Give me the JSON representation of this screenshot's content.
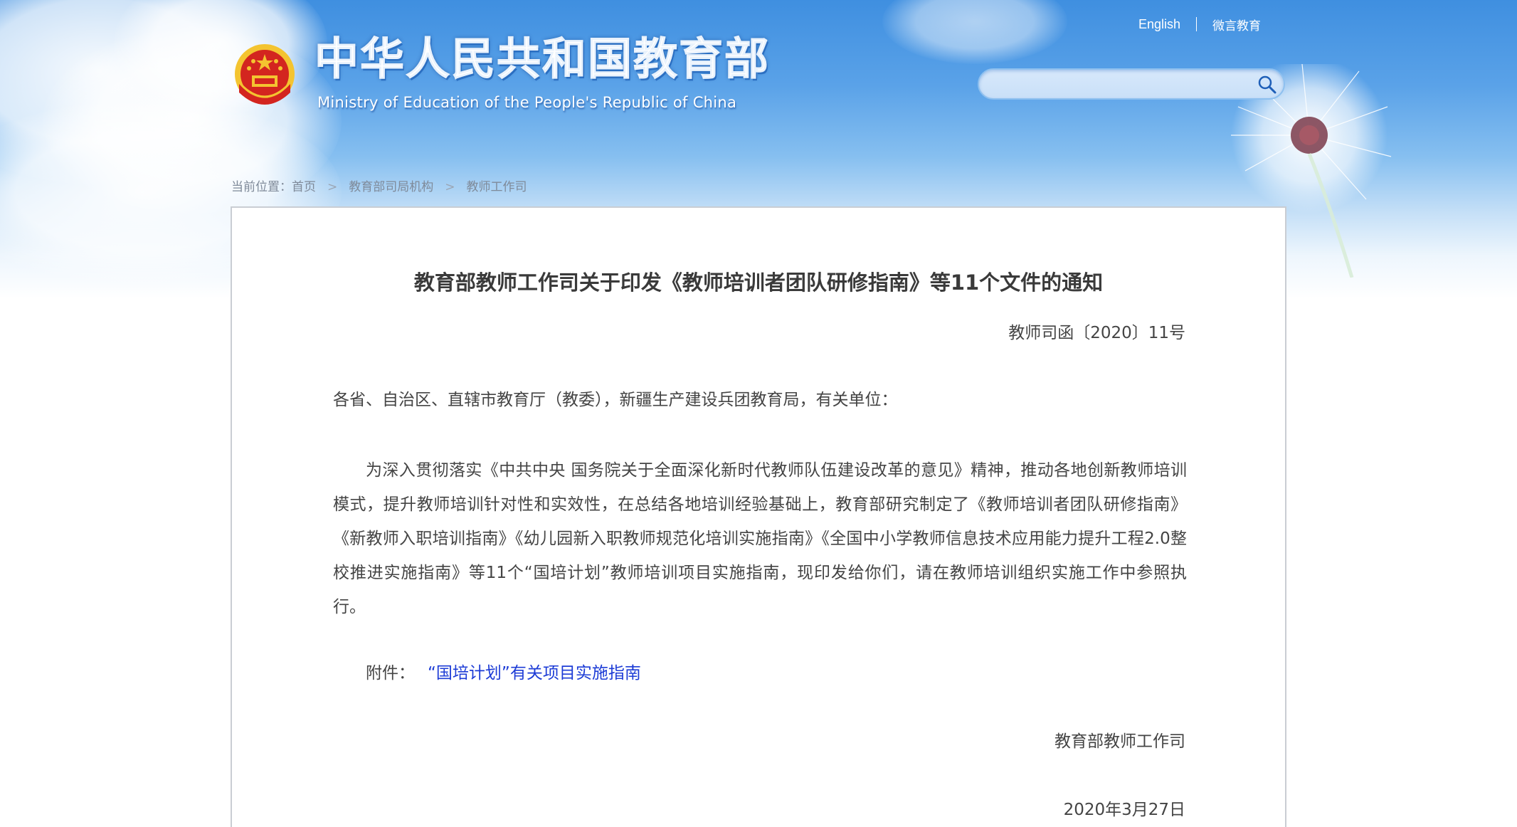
{
  "header": {
    "site_title_cn": "中华人民共和国教育部",
    "site_title_en": "Ministry of Education of the People's Republic of China",
    "links": {
      "english": "English",
      "weiyan": "微言教育"
    },
    "search": {
      "placeholder": ""
    }
  },
  "breadcrumb": {
    "prefix": "当前位置：",
    "items": [
      "首页",
      "教育部司局机构",
      "教师工作司"
    ],
    "separator": ">"
  },
  "article": {
    "title": "教育部教师工作司关于印发《教师培训者团队研修指南》等11个文件的通知",
    "doc_number": "教师司函〔2020〕11号",
    "salutation": "各省、自治区、直辖市教育厅（教委），新疆生产建设兵团教育局，有关单位：",
    "body": "为深入贯彻落实《中共中央 国务院关于全面深化新时代教师队伍建设改革的意见》精神，推动各地创新教师培训模式，提升教师培训针对性和实效性，在总结各地培训经验基础上，教育部研究制定了《教师培训者团队研修指南》《新教师入职培训指南》《幼儿园新入职教师规范化培训实施指南》《全国中小学教师信息技术应用能力提升工程2.0整校推进实施指南》等11个“国培计划”教师培训项目实施指南，现印发给你们，请在教师培训组织实施工作中参照执行。",
    "attachment_label": "附件：",
    "attachment_link": "“国培计划”有关项目实施指南",
    "signature": "教育部教师工作司",
    "date": "2020年3月27日"
  },
  "colors": {
    "sky_top": "#3f8fe0",
    "link_blue": "#1d3cd6",
    "emblem_red": "#d3251f",
    "emblem_gold": "#f4c430"
  },
  "icons": {
    "search": "search-icon",
    "emblem": "national-emblem-icon"
  }
}
